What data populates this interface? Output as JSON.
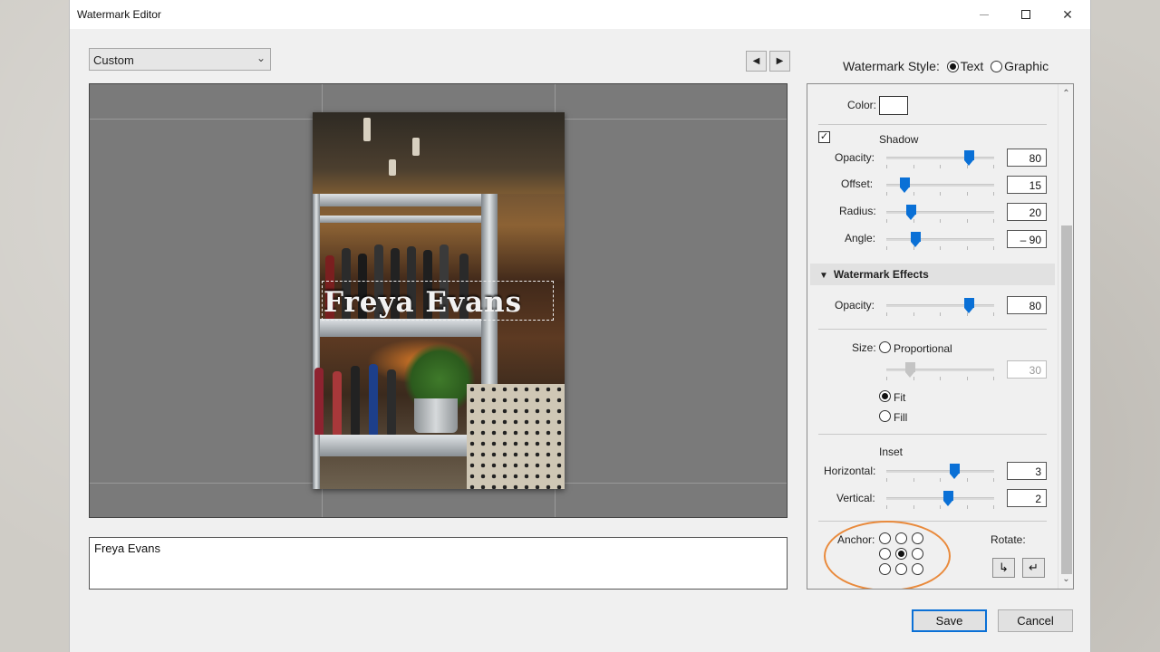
{
  "window": {
    "title": "Watermark Editor"
  },
  "preset": {
    "value": "Custom"
  },
  "nav": {
    "prev": "◀",
    "next": "▶"
  },
  "watermark_text": "Freya Evans",
  "style": {
    "label": "Watermark Style:",
    "options": [
      "Text",
      "Graphic"
    ],
    "selected": "Text"
  },
  "panel": {
    "color_label": "Color:",
    "shadow": {
      "checked": true,
      "label": "Shadow",
      "opacity": {
        "label": "Opacity:",
        "value": "80"
      },
      "offset": {
        "label": "Offset:",
        "value": "15"
      },
      "radius": {
        "label": "Radius:",
        "value": "20"
      },
      "angle": {
        "label": "Angle:",
        "value": "– 90"
      }
    },
    "effects": {
      "title": "Watermark Effects",
      "opacity": {
        "label": "Opacity:",
        "value": "80"
      },
      "size_label": "Size:",
      "size_options": [
        "Proportional",
        "Fit",
        "Fill"
      ],
      "size_selected": "Fit",
      "proportional_value": "30",
      "inset_label": "Inset",
      "horizontal": {
        "label": "Horizontal:",
        "value": "3"
      },
      "vertical": {
        "label": "Vertical:",
        "value": "2"
      },
      "anchor_label": "Anchor:",
      "anchor_selected": "center",
      "rotate_label": "Rotate:",
      "rotate_cw": "↳",
      "rotate_ccw": "↵"
    }
  },
  "buttons": {
    "save": "Save",
    "cancel": "Cancel"
  },
  "colors": {
    "accent": "#0a70d6",
    "highlight": "#e98a3c"
  }
}
